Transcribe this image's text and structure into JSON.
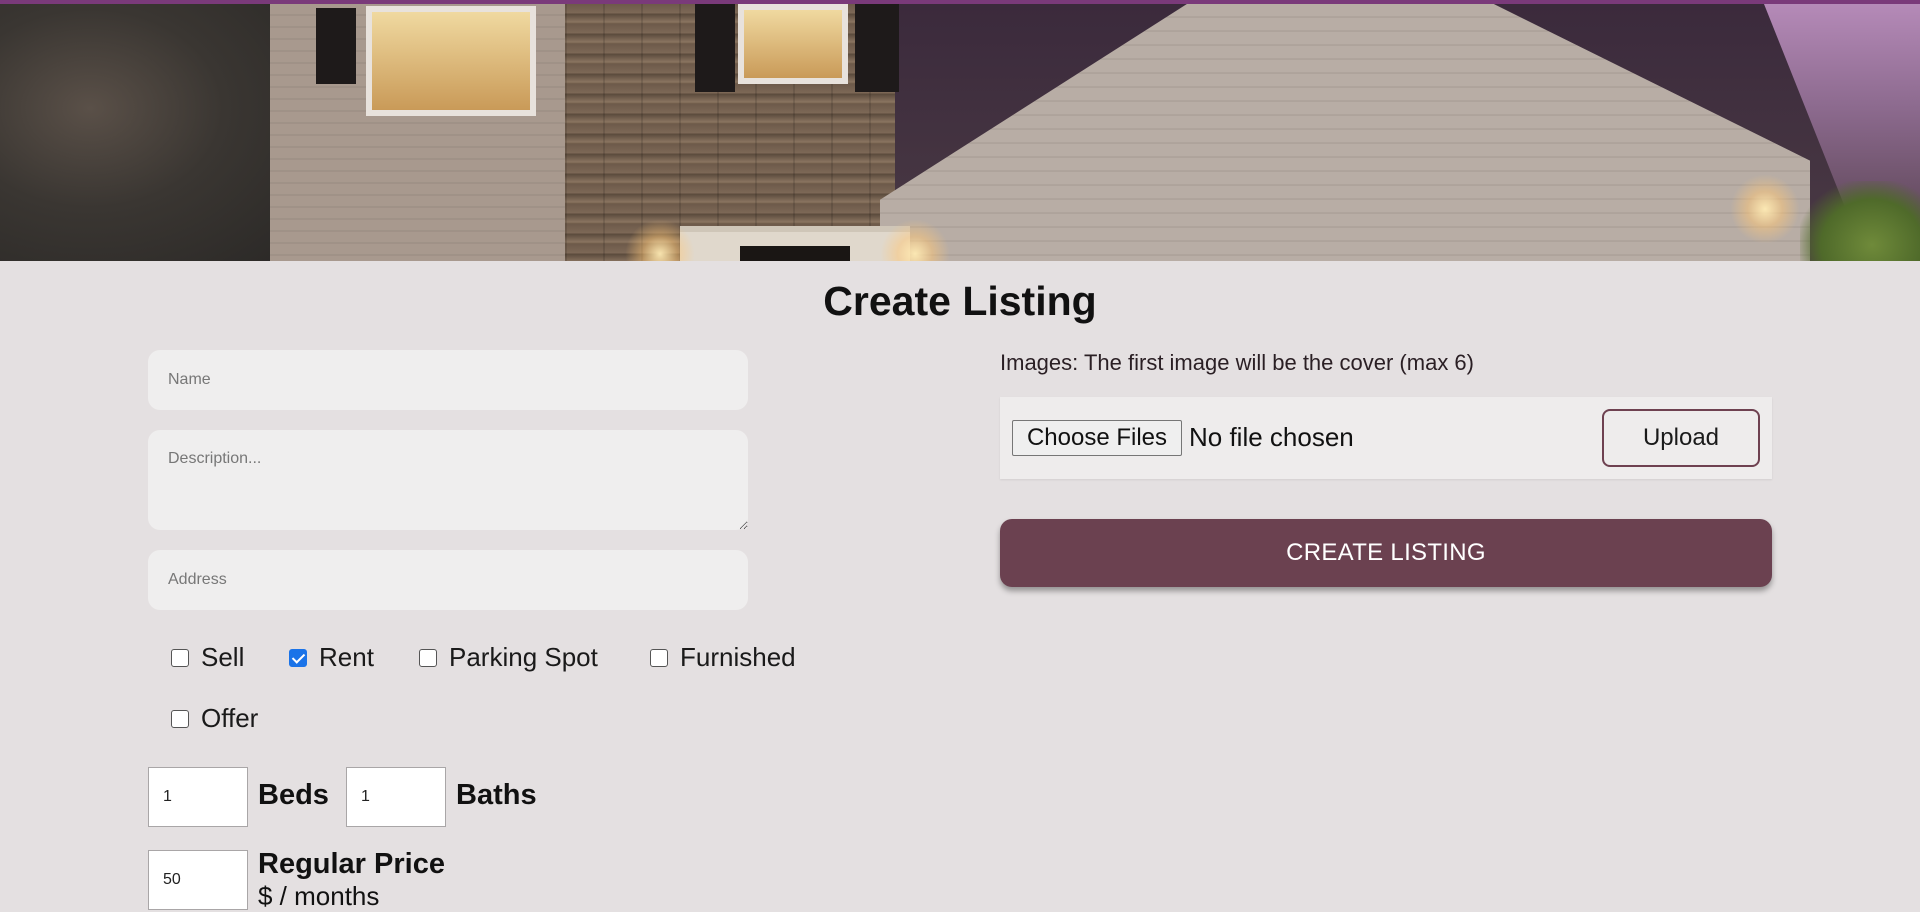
{
  "page": {
    "title": "Create Listing"
  },
  "form": {
    "name_placeholder": "Name",
    "description_placeholder": "Description...",
    "address_placeholder": "Address",
    "checkboxes": [
      {
        "label": "Sell",
        "checked": false
      },
      {
        "label": "Rent",
        "checked": true
      },
      {
        "label": "Parking Spot",
        "checked": false
      },
      {
        "label": "Furnished",
        "checked": false
      },
      {
        "label": "Offer",
        "checked": false
      }
    ],
    "beds_value": "1",
    "beds_label": "Beds",
    "baths_value": "1",
    "baths_label": "Baths",
    "regular_price_value": "50",
    "regular_price_label": "Regular Price",
    "regular_price_unit": "$ / months"
  },
  "images": {
    "label": "Images: The first image will be the cover (max 6)",
    "choose_button": "Choose Files",
    "no_file_text": "No file chosen",
    "upload_button": "Upload"
  },
  "actions": {
    "create_button": "CREATE LISTING"
  },
  "colors": {
    "background": "#e4e0e1",
    "accent": "#6b4150",
    "checkbox_checked": "#1a73e8"
  },
  "icons": {
    "hero_image": "house-photo"
  }
}
